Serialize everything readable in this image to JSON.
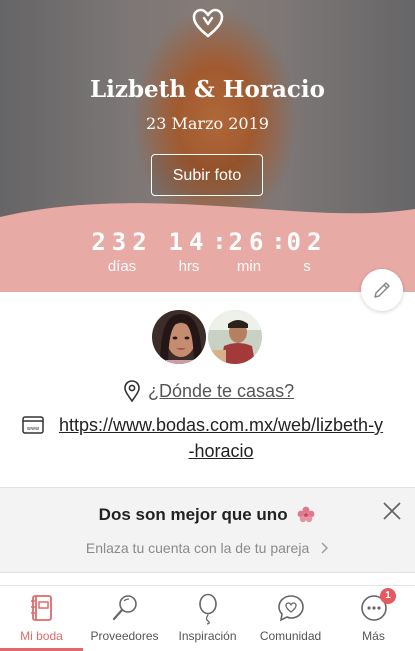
{
  "header": {
    "couple_names": "Lizbeth & Horacio",
    "wedding_date": "23 Marzo 2019",
    "upload_button": "Subir foto"
  },
  "countdown": {
    "days": "232",
    "days_label": "días",
    "hours": "14",
    "hours_label": "hrs",
    "minutes": "26",
    "minutes_label": "min",
    "seconds": "02",
    "seconds_label": "s"
  },
  "profile": {
    "location_link": "¿Dónde te casas?",
    "website_url": "https://www.bodas.com.mx/web/lizbeth-y-horacio",
    "website_url_line1": "https://www.bodas.com.mx/web/lizbeth-y",
    "website_url_line2": "-horacio"
  },
  "promo": {
    "title": "Dos son mejor que uno",
    "subtitle": "Enlaza tu cuenta con la de tu pareja"
  },
  "bottom_nav": {
    "items": [
      {
        "label": "Mi boda",
        "icon": "wedding-book-icon",
        "active": true
      },
      {
        "label": "Proveedores",
        "icon": "search-icon",
        "active": false
      },
      {
        "label": "Inspiración",
        "icon": "balloon-icon",
        "active": false
      },
      {
        "label": "Comunidad",
        "icon": "heart-chat-icon",
        "active": false
      },
      {
        "label": "Más",
        "icon": "more-icon",
        "active": false
      }
    ],
    "more_badge": "1"
  },
  "colors": {
    "accent": "#e06a6a",
    "countdown_band": "#e8aaa5",
    "badge": "#e8585f"
  }
}
